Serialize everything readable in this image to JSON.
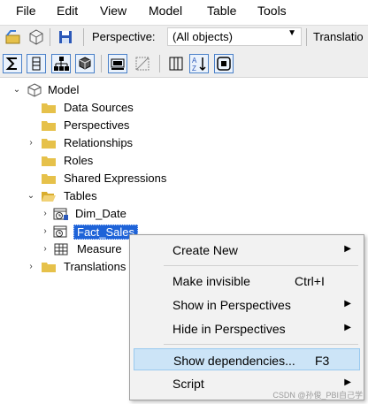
{
  "menubar": {
    "items": [
      "File",
      "Edit",
      "View",
      "Model",
      "Table",
      "Tools"
    ]
  },
  "toolbar": {
    "perspective_label": "Perspective:",
    "perspective_value": "(All objects)",
    "translation_label": "Translatio"
  },
  "tree": {
    "model": "Model",
    "data_sources": "Data Sources",
    "perspectives": "Perspectives",
    "relationships": "Relationships",
    "roles": "Roles",
    "shared_expressions": "Shared Expressions",
    "tables": "Tables",
    "dim_date": "Dim_Date",
    "fact_sales": "Fact_Sales",
    "measure": "Measure",
    "translations": "Translations"
  },
  "context_menu": {
    "create_new": "Create New",
    "make_invisible": "Make invisible",
    "make_invisible_shortcut": "Ctrl+I",
    "show_in_perspectives": "Show in Perspectives",
    "hide_in_perspectives": "Hide in Perspectives",
    "show_dependencies": "Show dependencies...",
    "show_dependencies_shortcut": "F3",
    "script": "Script"
  },
  "watermark": "CSDN @孙俊_PBI自己学",
  "colors": {
    "folder": "#e6c14a",
    "selection": "#1e63d8",
    "menu_highlight": "#cce4f7"
  }
}
